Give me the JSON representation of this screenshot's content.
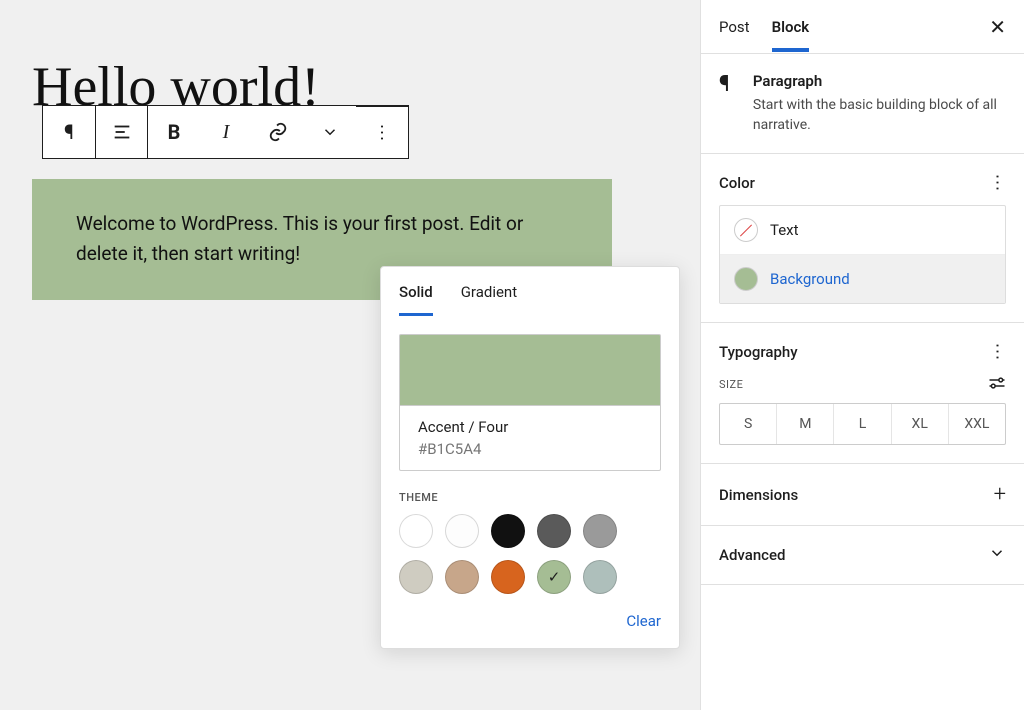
{
  "editor": {
    "title": "Hello world!",
    "paragraph": "Welcome to WordPress. This is your first post. Edit or delete it, then start writing!"
  },
  "popover": {
    "tabs": {
      "solid": "Solid",
      "gradient": "Gradient"
    },
    "selected_name": "Accent / Four",
    "selected_hex": "#B1C5A4",
    "theme_label": "THEME",
    "clear": "Clear",
    "swatches": [
      {
        "name": "base",
        "hex": "#ffffff"
      },
      {
        "name": "base-two",
        "hex": "#fdfdfd"
      },
      {
        "name": "black",
        "hex": "#111111"
      },
      {
        "name": "dark-gray",
        "hex": "#5a5a5a"
      },
      {
        "name": "gray",
        "hex": "#9a9a9a"
      },
      {
        "name": "tan",
        "hex": "#cfccc1"
      },
      {
        "name": "sand",
        "hex": "#c7a68a"
      },
      {
        "name": "orange",
        "hex": "#d7641e"
      },
      {
        "name": "accent-four",
        "hex": "#a5bd94",
        "selected": true
      },
      {
        "name": "sage",
        "hex": "#aebfbb"
      }
    ]
  },
  "sidebar": {
    "tabs": {
      "post": "Post",
      "block": "Block"
    },
    "block": {
      "name": "Paragraph",
      "desc": "Start with the basic building block of all narrative."
    },
    "color": {
      "title": "Color",
      "text_label": "Text",
      "bg_label": "Background",
      "bg_swatch": "#a5bd94"
    },
    "typo": {
      "title": "Typography",
      "size_label": "SIZE",
      "sizes": [
        "S",
        "M",
        "L",
        "XL",
        "XXL"
      ]
    },
    "dimensions": "Dimensions",
    "advanced": "Advanced"
  }
}
